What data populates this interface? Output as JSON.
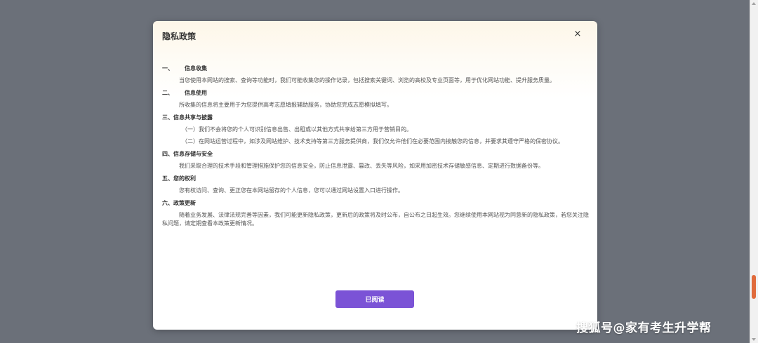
{
  "modal": {
    "title": "隐私政策",
    "close_glyph": "×",
    "sections": [
      {
        "num": "一、",
        "heading": "信息收集",
        "paragraphs": [
          "当您使用本网站的搜索、查询等功能时，我们可能收集您的操作记录，包括搜索关键词、浏览的高校及专业页面等，用于优化网站功能、提升服务质量。"
        ]
      },
      {
        "num": "二、",
        "heading": "信息使用",
        "paragraphs": [
          "所收集的信息将主要用于为您提供高考志愿填报辅助服务，协助您完成志愿模拟填写。"
        ]
      },
      {
        "num": "",
        "heading": "三、信息共享与披露",
        "paragraphs": [
          "（一）我们不会将您的个人可识别信息出售、出租或以其他方式共享给第三方用于营销目的。",
          "（二）在网站运营过程中，如涉及网站维护、技术支持等第三方服务提供商，我们仅允许他们在必要范围内接触您的信息，并要求其遵守严格的保密协议。"
        ]
      },
      {
        "num": "",
        "heading": "四、信息存储与安全",
        "paragraphs": [
          "我们采取合理的技术手段和管理措施保护您的信息安全，防止信息泄露、篡改、丢失等风险，如采用加密技术存储敏感信息、定期进行数据备份等。"
        ]
      },
      {
        "num": "",
        "heading": "五、您的权利",
        "paragraphs": [
          "您有权访问、查询、更正您在本网站留存的个人信息，您可以通过网站设置入口进行操作。"
        ]
      },
      {
        "num": "",
        "heading": "六、政策更新",
        "paragraphs": [
          "随着业务发展、法律法规完善等因素，我们可能更新隐私政策，更新后的政策将及时公布，自公布之日起生效。您继续使用本网站视为同意新的隐私政策，若您关注隐私问题，请定期查看本政策更新情况。"
        ]
      }
    ],
    "button_label": "已阅读"
  },
  "watermark": "搜狐号@家有考生升学帮",
  "colors": {
    "backdrop": "#6b7079",
    "button": "#7b53d6",
    "scroll_thumb": "#e06b3c"
  }
}
